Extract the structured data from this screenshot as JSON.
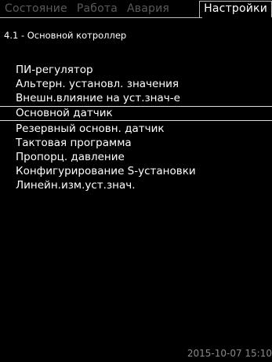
{
  "tabs": [
    {
      "label": "Состояние"
    },
    {
      "label": "Работа"
    },
    {
      "label": "Авария"
    },
    {
      "label": "Настройки"
    }
  ],
  "breadcrumb": "4.1 - Основной котроллер",
  "menu": {
    "items": [
      {
        "label": "ПИ-регулятор"
      },
      {
        "label": "Альтерн. установл. значения"
      },
      {
        "label": "Внешн.влияние на уст.знач-е"
      },
      {
        "label": "Основной датчик"
      },
      {
        "label": "Резервный основн. датчик"
      },
      {
        "label": "Тактовая программа"
      },
      {
        "label": "Пропорц. давление"
      },
      {
        "label": "Конфигурирование S-установки"
      },
      {
        "label": "Линейн.изм.уст.знач."
      }
    ],
    "selected_index": 3
  },
  "status_bar": {
    "datetime": "2015-10-07 15:10"
  },
  "colors": {
    "background": "#000000",
    "text": "#ffffff",
    "inactive_tab": "#5a5a5a",
    "border": "#bcbcbc",
    "timestamp": "#8a8a8a"
  }
}
